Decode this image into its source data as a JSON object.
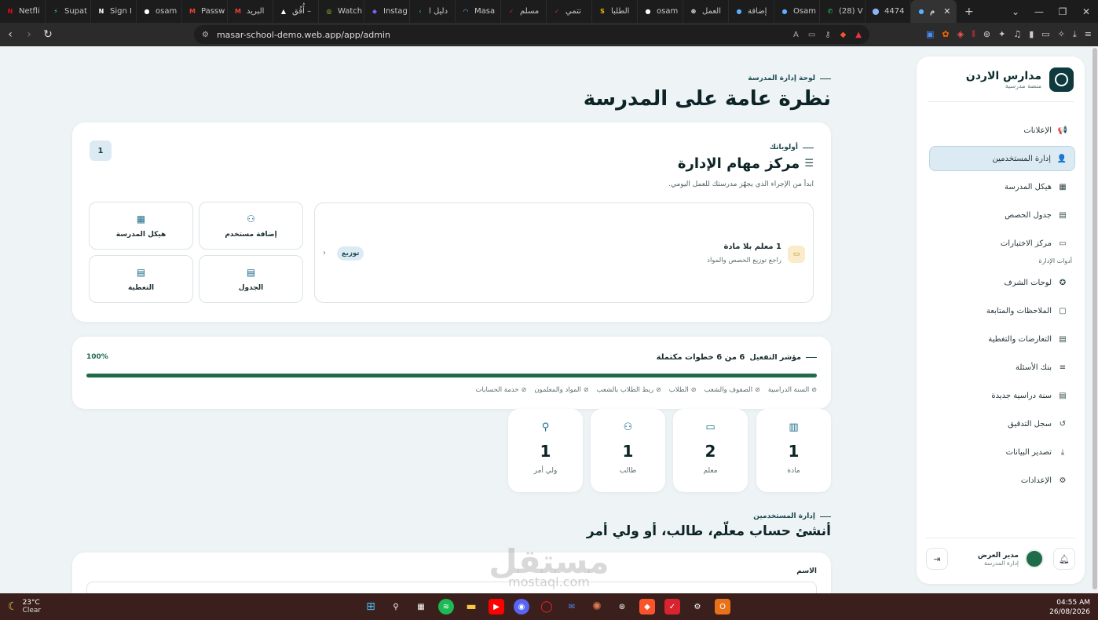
{
  "browser": {
    "tabs": [
      {
        "label": "Netfli",
        "icon": "netflix-icon",
        "color": "#e50914",
        "glyph": "N"
      },
      {
        "label": "Supat",
        "icon": "supabase-icon",
        "color": "#3ecf8e",
        "glyph": "⚡"
      },
      {
        "label": "Sign I",
        "icon": "notion-icon",
        "color": "#ffffff",
        "glyph": "N"
      },
      {
        "label": "osam",
        "icon": "github-icon",
        "color": "#ffffff",
        "glyph": "●"
      },
      {
        "label": "Passw",
        "icon": "gmail-icon",
        "color": "#ea4335",
        "glyph": "M"
      },
      {
        "label": "البريد",
        "icon": "gmail-icon",
        "color": "#ea4335",
        "glyph": "M"
      },
      {
        "label": "أُفُق –",
        "icon": "vercel-icon",
        "color": "#ffffff",
        "glyph": "▲"
      },
      {
        "label": "Watch",
        "icon": "watch-icon",
        "color": "#9bd33c",
        "glyph": "◎"
      },
      {
        "label": "Instag",
        "icon": "linear-icon",
        "color": "#7b61ff",
        "glyph": "◆"
      },
      {
        "label": "دليل ا",
        "icon": "guide-icon",
        "color": "#17a673",
        "glyph": "‹"
      },
      {
        "label": "Masa",
        "icon": "masar-icon",
        "color": "#5ab0ff",
        "glyph": "◠"
      },
      {
        "label": "مسلم",
        "icon": "todo-icon",
        "color": "#d9232f",
        "glyph": "✓"
      },
      {
        "label": "تتمي",
        "icon": "todo-icon",
        "color": "#d9232f",
        "glyph": "✓"
      },
      {
        "label": "الطلبا",
        "icon": "sheets-icon",
        "color": "#f4b400",
        "glyph": "S"
      },
      {
        "label": "osam",
        "icon": "github-icon",
        "color": "#ffffff",
        "glyph": "●"
      },
      {
        "label": "العمل",
        "icon": "openai-icon",
        "color": "#ffffff",
        "glyph": "⊛"
      },
      {
        "label": "إضافة",
        "icon": "masar-icon",
        "color": "#5ab0ff",
        "glyph": "●"
      },
      {
        "label": "Osam",
        "icon": "masar-icon",
        "color": "#5ab0ff",
        "glyph": "●"
      },
      {
        "label": "(28) V",
        "icon": "whatsapp-icon",
        "color": "#25d366",
        "glyph": "✆"
      },
      {
        "label": "4474",
        "icon": "link-icon",
        "color": "#8ab4f8",
        "glyph": "⬤"
      },
      {
        "label": "م",
        "icon": "masar-icon",
        "color": "#5ab0ff",
        "glyph": "●",
        "active": true
      }
    ],
    "url": "masar-school-demo.web.app/app/admin"
  },
  "sidebar": {
    "brand_name": "مدارس الاردن",
    "brand_sub": "منصة مدرسية",
    "items": [
      {
        "label": "الإعلانات",
        "icon": "megaphone-icon",
        "glyph": "📢"
      },
      {
        "label": "إدارة المستخدمين",
        "icon": "user-cog-icon",
        "glyph": "👤",
        "active": true
      },
      {
        "label": "هيكل المدرسة",
        "icon": "building-icon",
        "glyph": "▦"
      },
      {
        "label": "جدول الحصص",
        "icon": "calendar-icon",
        "glyph": "▤"
      },
      {
        "label": "مركز الاختبارات",
        "icon": "clipboard-icon",
        "glyph": "▭"
      }
    ],
    "group_label": "أدوات الإدارة",
    "tools": [
      {
        "label": "لوحات الشرف",
        "icon": "award-icon",
        "glyph": "✪"
      },
      {
        "label": "الملاحظات والمتابعة",
        "icon": "message-icon",
        "glyph": "▢"
      },
      {
        "label": "التعارضات والتغطية",
        "icon": "calendar-alert-icon",
        "glyph": "▤"
      },
      {
        "label": "بنك الأسئلة",
        "icon": "database-icon",
        "glyph": "≡"
      },
      {
        "label": "سنة دراسية جديدة",
        "icon": "calendar-plus-icon",
        "glyph": "▤"
      },
      {
        "label": "سجل التدقيق",
        "icon": "history-icon",
        "glyph": "↺"
      },
      {
        "label": "تصدير البيانات",
        "icon": "download-icon",
        "glyph": "⤓"
      },
      {
        "label": "الإعدادات",
        "icon": "gear-icon",
        "glyph": "⚙"
      }
    ],
    "user_name": "مدير العرض",
    "user_role": "إدارة المدرسة"
  },
  "header": {
    "eyebrow": "لوحة إدارة المدرسة",
    "title": "نظرة عامة على المدرسة"
  },
  "tasks": {
    "badge": "1",
    "eyebrow": "أولوياتك",
    "title": "مركز مهام الإدارة",
    "subtitle": "ابدأ من الإجراء الذي يجهّز مدرستك للعمل اليومي.",
    "priority_title": "1 معلم بلا مادة",
    "priority_sub": "راجع توزيع الحصص والمواد",
    "priority_tag": "توزيع",
    "quick_actions": {
      "add_user": "إضافة مستخدم",
      "structure": "هيكل المدرسة",
      "schedule": "الجدول",
      "coverage": "التغطية"
    }
  },
  "activation": {
    "label": "مؤشر التفعيل",
    "summary": "6 من 6 خطوات مكتملة",
    "percent_label": "100%",
    "progress": 1.0,
    "steps": [
      "السنة الدراسية",
      "الصفوف والشعب",
      "الطلاب",
      "ربط الطلاب بالشعب",
      "المواد والمعلمون",
      "خدمة الحسابات"
    ]
  },
  "stats": {
    "subject": {
      "value": "1",
      "label": "مادة",
      "icon": "books-icon"
    },
    "teacher": {
      "value": "2",
      "label": "معلم",
      "icon": "presentation-icon"
    },
    "student": {
      "value": "1",
      "label": "طالب",
      "icon": "users-icon"
    },
    "parent": {
      "value": "1",
      "label": "ولي أمر",
      "icon": "user-heart-icon"
    }
  },
  "user_mgmt": {
    "eyebrow": "إدارة المستخدمين",
    "title": "أنشئ حساب معلّم، طالب، أو ولي أمر",
    "name_label": "الاسم"
  },
  "watermark": {
    "big": "مستقل",
    "small": "mostaql.com"
  },
  "taskbar": {
    "temp": "23°C",
    "condition": "Clear",
    "time": "04:55 AM",
    "date": "26/08/2026"
  },
  "colors": {
    "accent": "#1e6a49",
    "brand": "#0e3a3e",
    "active_nav": "#dcebf3"
  }
}
